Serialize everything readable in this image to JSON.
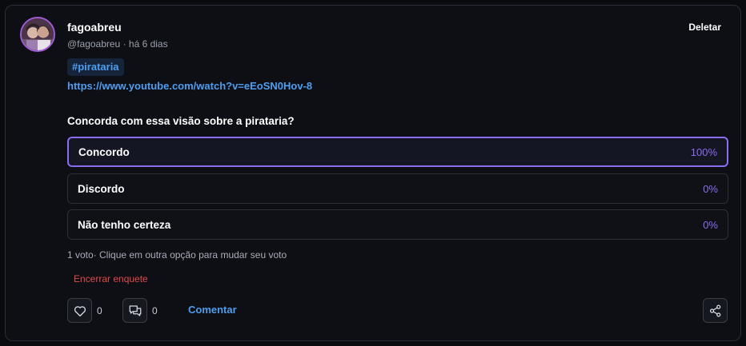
{
  "post": {
    "username": "fagoabreu",
    "handle": "@fagoabreu",
    "time": "há 6 dias",
    "meta": "@fagoabreu · há 6 dias",
    "delete_label": "Deletar",
    "hashtag": "#pirataria",
    "link": "https://www.youtube.com/watch?v=eEoSN0Hov-8"
  },
  "poll": {
    "question": "Concorda com essa visão sobre a pirataria?",
    "options": [
      {
        "label": "Concordo",
        "percent": "100%",
        "selected": true
      },
      {
        "label": "Discordo",
        "percent": "0%",
        "selected": false
      },
      {
        "label": "Não tenho certeza",
        "percent": "0%",
        "selected": false
      }
    ],
    "votes_text": "1 voto· Clique em outra opção para mudar seu voto",
    "close_label": "Encerrar enquete"
  },
  "actions": {
    "likes": "0",
    "comments": "0",
    "comment_label": "Comentar"
  },
  "icons": {
    "like": "heart-icon",
    "comment": "comments-icon",
    "share": "share-icon"
  },
  "colors": {
    "accent": "#8b6df0",
    "link": "#4d9ef0",
    "danger": "#e04a4a",
    "avatar_ring": "#a15bd6"
  }
}
